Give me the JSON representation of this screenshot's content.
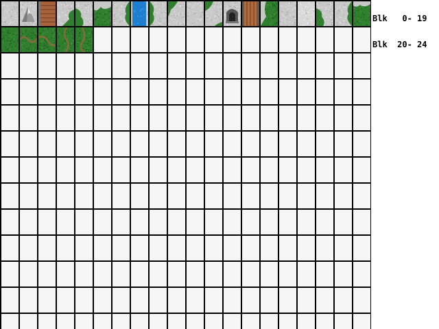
{
  "labels": [
    "Blk   0- 19",
    "Blk  20- 24"
  ],
  "tiles": [
    {
      "kind": "rock",
      "name": "tile-rock"
    },
    {
      "kind": "mountain",
      "name": "tile-mountain"
    },
    {
      "kind": "brick",
      "name": "tile-brick"
    },
    {
      "kind": "rock-grass-edge-br",
      "name": "tile-rock-grass-edge"
    },
    {
      "kind": "rock-grass-edge-bl",
      "name": "tile-rock-grass-edge"
    },
    {
      "kind": "grass-rock-edge",
      "name": "tile-grass-rock-edge"
    },
    {
      "kind": "rock-grass-edge-r",
      "name": "tile-rock-grass-edge"
    },
    {
      "kind": "water",
      "name": "tile-water"
    },
    {
      "kind": "rock-grass-edge-l",
      "name": "tile-rock-grass-edge"
    },
    {
      "kind": "rock-grass-edge-tl",
      "name": "tile-rock-grass-edge"
    },
    {
      "kind": "rock",
      "name": "tile-rock"
    },
    {
      "kind": "rock-grass-corner",
      "name": "tile-rock-grass-corner"
    },
    {
      "kind": "cave",
      "name": "tile-cave-entrance"
    },
    {
      "kind": "wood",
      "name": "tile-wood-bridge"
    },
    {
      "kind": "grass-rock-left",
      "name": "tile-grass-rock-edge"
    },
    {
      "kind": "rock",
      "name": "tile-rock"
    },
    {
      "kind": "rock-light",
      "name": "tile-rock"
    },
    {
      "kind": "rock-grass-edge-bl",
      "name": "tile-rock-grass-edge"
    },
    {
      "kind": "rock-grass-edge-r",
      "name": "tile-rock-grass-edge"
    },
    {
      "kind": "grass-rock-edge-t",
      "name": "tile-grass-rock-edge"
    },
    {
      "kind": "grass",
      "name": "tile-grass"
    },
    {
      "kind": "path-h",
      "name": "tile-path"
    },
    {
      "kind": "path-curve",
      "name": "tile-path"
    },
    {
      "kind": "path-v",
      "name": "tile-path"
    },
    {
      "kind": "path-v2",
      "name": "tile-path"
    }
  ]
}
